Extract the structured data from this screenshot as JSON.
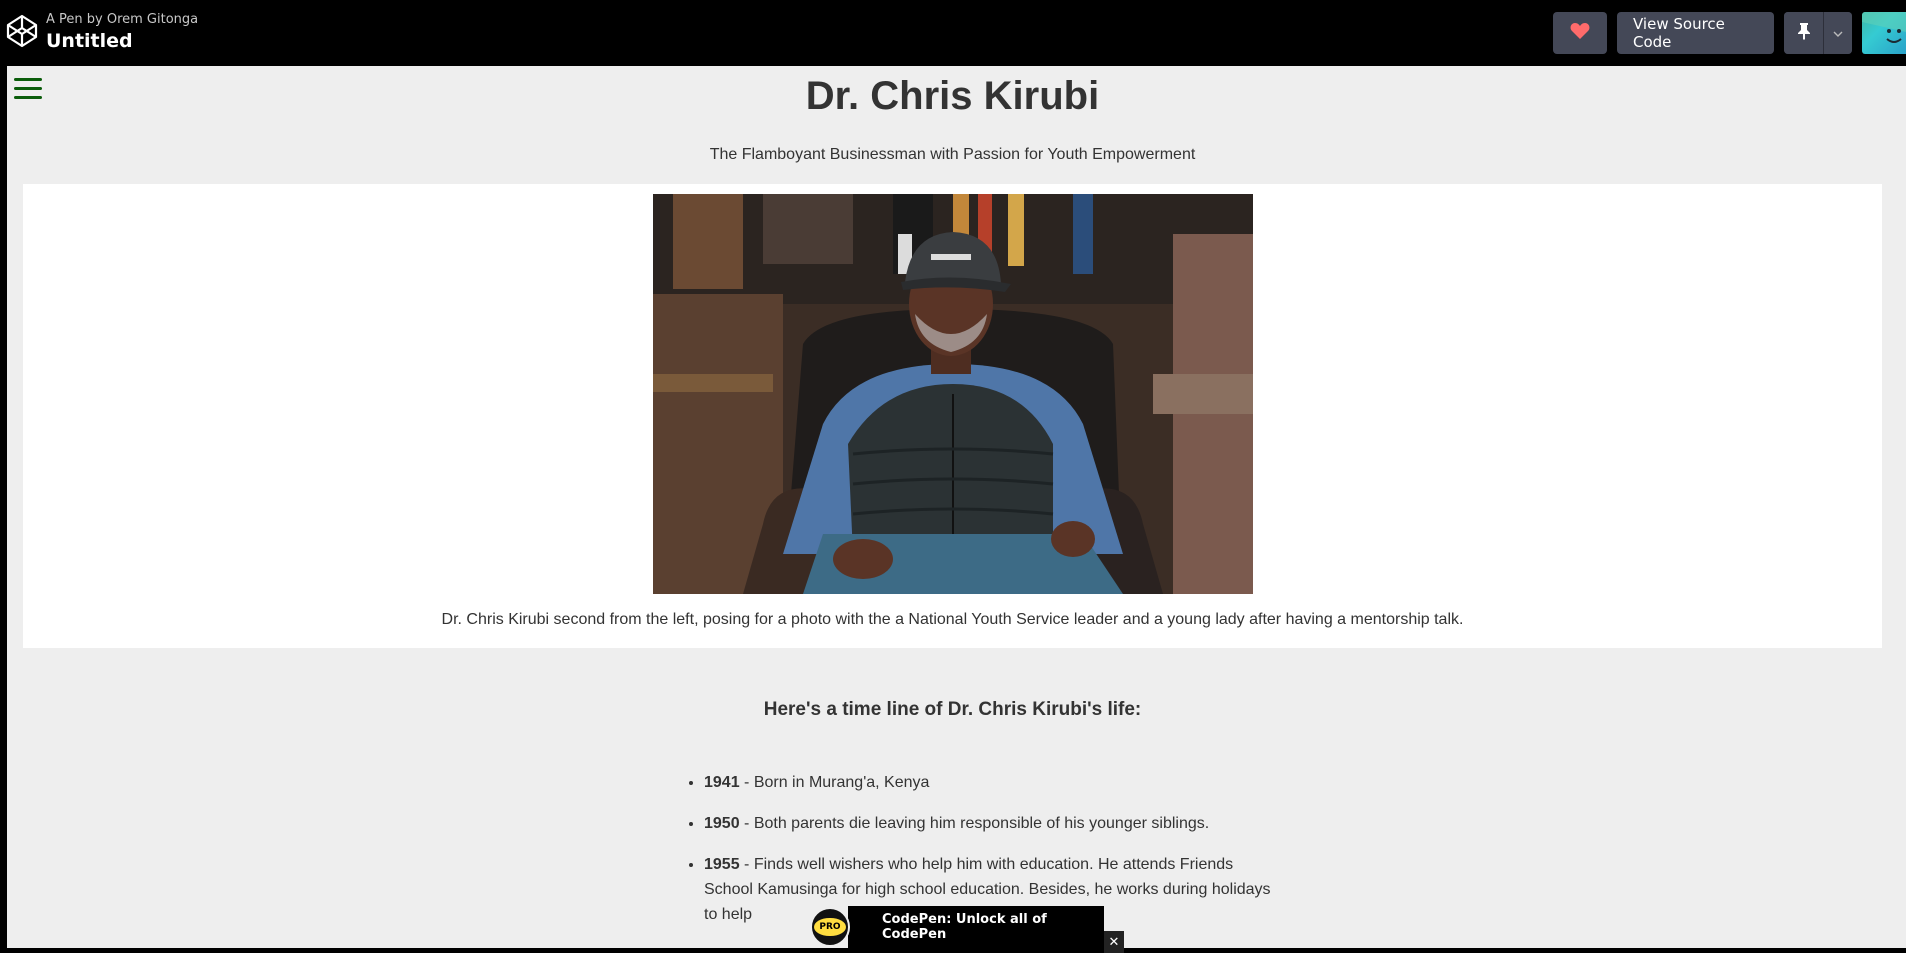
{
  "topbar": {
    "pen_author_line": "A Pen by Orem Gitonga",
    "pen_title": "Untitled",
    "view_source_label": "View Source Code",
    "heart_color": "#ff6b6b"
  },
  "page": {
    "title": "Dr. Chris Kirubi",
    "subtitle": "The Flamboyant Businessman with Passion for Youth Empowerment",
    "image_alt": "Dr. Chris Kirubi seated in a leather armchair wearing a cap and puffer vest",
    "caption": "Dr. Chris Kirubi second from the left, posing for a photo with the a National Youth Service leader and a young lady after having a mentorship talk.",
    "timeline_heading": "Here's a time line of Dr. Chris Kirubi's life:",
    "timeline": [
      {
        "year": "1941",
        "text": " - Born in Murang'a, Kenya"
      },
      {
        "year": "1950",
        "text": " - Both parents die leaving him responsible of his younger siblings."
      },
      {
        "year": "1955",
        "text": " - Finds well wishers who help him with education. He attends Friends School Kamusinga for high school education. Besides, he works during holidays to help"
      }
    ]
  },
  "pro_banner": {
    "badge": "PRO",
    "text": "CodePen: Unlock all of CodePen",
    "close": "✕"
  },
  "colors": {
    "menu_icon": "#0b5d0b",
    "preview_bg": "#eeeeee",
    "button_bg": "#444857"
  }
}
